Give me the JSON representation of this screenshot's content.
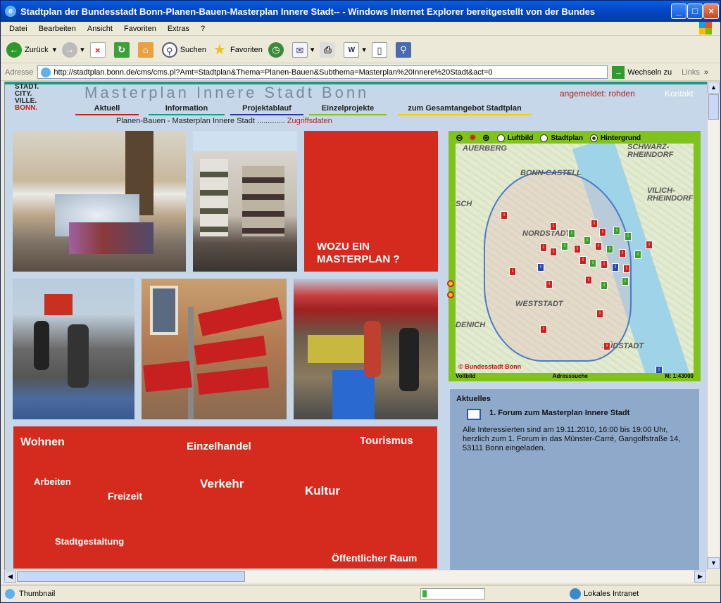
{
  "window": {
    "title": "Stadtplan der Bundesstadt Bonn-Planen-Bauen-Masterplan Innere Stadt-- - Windows Internet Explorer bereitgestellt von der Bundes"
  },
  "menu": [
    "Datei",
    "Bearbeiten",
    "Ansicht",
    "Favoriten",
    "Extras",
    "?"
  ],
  "toolbar": {
    "back": "Zurück",
    "search": "Suchen",
    "favorites": "Favoriten"
  },
  "address": {
    "label": "Adresse",
    "url": "http://stadtplan.bonn.de/cms/cms.pl?Amt=Stadtplan&Thema=Planen-Bauen&Subthema=Masterplan%20Innere%20Stadt&act=0",
    "go": "Wechseln zu",
    "links": "Links"
  },
  "site": {
    "logo": [
      "STADT.",
      "CITY.",
      "VILLE.",
      "BONN."
    ],
    "title": "Masterplan Innere Stadt Bonn",
    "login": "angemeldet: rohden",
    "contact": "Kontakt",
    "nav": [
      {
        "label": "Aktuell",
        "color": "#c81e1e"
      },
      {
        "label": "Information",
        "color": "#1a9a8a"
      },
      {
        "label": "Projektablauf",
        "color": "#2a3aa0"
      },
      {
        "label": "Einzelprojekte",
        "color": "#7fc31c"
      },
      {
        "label": "zum Gesamtangebot Stadtplan",
        "color": "#f2d000"
      }
    ],
    "breadcrumb": "Planen-Bauen - Masterplan Innere Stadt .............",
    "access": "Zugriffsdaten",
    "question": "WOZU EIN MASTERPLAN ?",
    "themes": [
      "Wohnen",
      "Einzelhandel",
      "Tourismus",
      "Arbeiten",
      "Freizeit",
      "Verkehr",
      "Kultur",
      "Stadtgestaltung",
      "Öffentlicher Raum"
    ]
  },
  "map": {
    "options": [
      "Luftbild",
      "Stadtplan",
      "Hintergrund"
    ],
    "selected": "Hintergrund",
    "places": [
      "AUERBERG",
      "BONN-CASTELL",
      "SCHWARZ-RHEINDORF",
      "VILICH-RHEINDORF",
      "NORDSTADT",
      "WESTSTADT",
      "DENICH",
      "SÜDSTADT",
      "SCH"
    ],
    "copyright": "© Bundesstadt Bonn",
    "footer": [
      "Vollbild",
      "Adresssuche",
      "M: 1:43000"
    ]
  },
  "news": {
    "heading": "Aktuelles",
    "item_title": "1. Forum zum Masterplan Innere Stadt",
    "item_text": "Alle Interessierten sind am 19.11.2010, 16:00 bis 19:00 Uhr, herzlich zum 1. Forum in das Münster-Carré, Gangolfstraße 14, 53111 Bonn eingeladen."
  },
  "status": {
    "left": "Thumbnail",
    "zone": "Lokales Intranet"
  }
}
